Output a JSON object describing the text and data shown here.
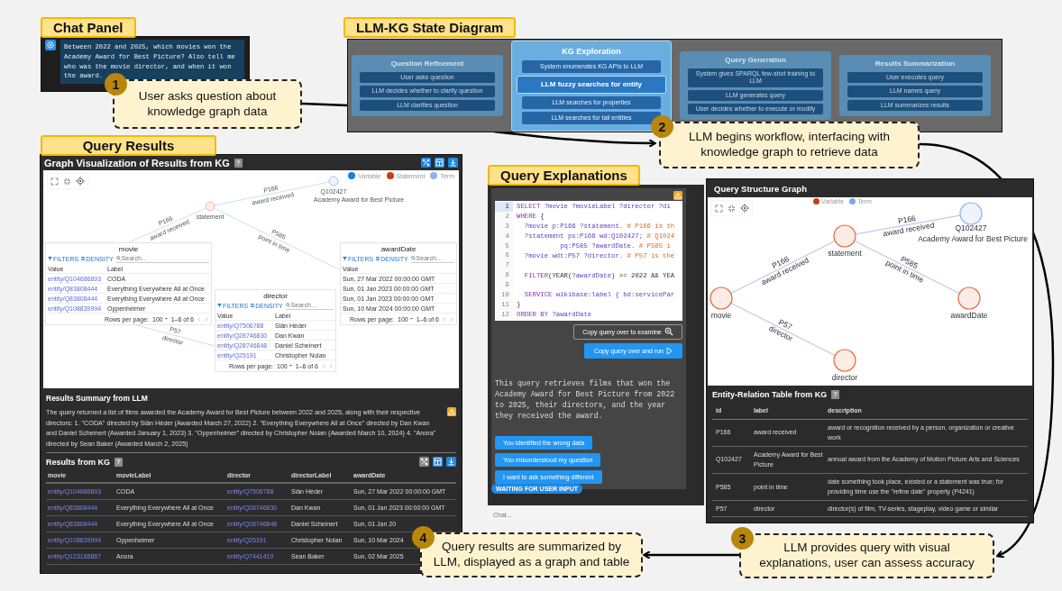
{
  "chat_panel": {
    "label": "Chat Panel",
    "message": "Between 2022 and 2025, which movies won the Academy Award for Best Picture? Also tell me who was the movie director, and when it won the award."
  },
  "state_diagram": {
    "label": "LLM-KG State Diagram",
    "stages": [
      {
        "title": "Question Refinement",
        "active": false,
        "steps": [
          {
            "text": "User asks question",
            "active": false
          },
          {
            "text": "LLM decides whether to clarify question",
            "active": false
          },
          {
            "text": "LLM clarifies question",
            "active": false
          }
        ]
      },
      {
        "title": "KG Exploration",
        "active": true,
        "steps": [
          {
            "text": "System enumerates KG APIs to LLM",
            "active": false
          },
          {
            "text": "LLM fuzzy searches for entity",
            "active": true
          },
          {
            "text": "LLM searches for properties",
            "active": false
          },
          {
            "text": "LLM searches for tail entities",
            "active": false
          }
        ]
      },
      {
        "title": "Query Generation",
        "active": false,
        "steps": [
          {
            "text": "System gives SPARQL few-shot training to LLM",
            "active": false
          },
          {
            "text": "LLM generates query",
            "active": false
          },
          {
            "text": "User decides whether to execute or modify",
            "active": false
          }
        ]
      },
      {
        "title": "Results Summarization",
        "active": false,
        "steps": [
          {
            "text": "User executes query",
            "active": false
          },
          {
            "text": "LLM names query",
            "active": false
          },
          {
            "text": "LLM summarizes results",
            "active": false
          }
        ]
      }
    ]
  },
  "query_results": {
    "label": "Query Results",
    "graph_panel": {
      "title": "Graph Visualization of Results from KG",
      "help": "?",
      "legend": [
        {
          "name": "Variable",
          "color": "#1a7cf5"
        },
        {
          "name": "Statement",
          "color": "#c2410c"
        },
        {
          "name": "Term",
          "color": "#8fb0f2"
        }
      ],
      "nodes": [
        {
          "label": "statement",
          "kind": "statement"
        },
        {
          "label": "Q102427",
          "sublabel": "Academy Award for Best Picture",
          "kind": "term"
        }
      ],
      "edges": [
        {
          "id": "P166",
          "label": "award received"
        },
        {
          "id": "P166",
          "label": "award received"
        },
        {
          "id": "P585",
          "label": "point in time"
        },
        {
          "id": "P57",
          "label": "director"
        }
      ],
      "tables": [
        {
          "title": "movie",
          "filters": "FILTERS",
          "density": "DENSITY",
          "search_placeholder": "Search…",
          "columns": [
            {
              "name": "Value",
              "kind": "link"
            },
            {
              "name": "Label",
              "kind": "text"
            }
          ],
          "rows": [
            [
              "entity/Q104686893",
              "CODA"
            ],
            [
              "entity/Q83808444",
              "Everything Everywhere All at Once"
            ],
            [
              "entity/Q83808444",
              "Everything Everywhere All at Once"
            ],
            [
              "entity/Q108839994",
              "Oppenheimer"
            ]
          ],
          "rows_per_page": "Rows per page:",
          "page_size": "100",
          "range": "1–6 of 6"
        },
        {
          "title": "director",
          "filters": "FILTERS",
          "density": "DENSITY",
          "search_placeholder": "Search…",
          "columns": [
            {
              "name": "Value",
              "kind": "link"
            },
            {
              "name": "Label",
              "kind": "text"
            }
          ],
          "rows": [
            [
              "entity/Q7506788",
              "Siân Héder"
            ],
            [
              "entity/Q28746830",
              "Dan Kwan"
            ],
            [
              "entity/Q28746848",
              "Daniel Scheinert"
            ],
            [
              "entity/Q25191",
              "Christopher Nolan"
            ]
          ],
          "rows_per_page": "Rows per page:",
          "page_size": "100",
          "range": "1–6 of 6"
        },
        {
          "title": "awardDate",
          "filters": "FILTERS",
          "density": "DENSITY",
          "search_placeholder": "Search…",
          "columns": [
            {
              "name": "Value",
              "kind": "text"
            }
          ],
          "rows": [
            [
              "Sun, 27 Mar 2022 00:00:00 GMT"
            ],
            [
              "Sun, 01 Jan 2023 00:00:00 GMT"
            ],
            [
              "Sun, 01 Jan 2023 00:00:00 GMT"
            ],
            [
              "Sun, 10 Mar 2024 00:00:00 GMT"
            ]
          ],
          "rows_per_page": "Rows per page:",
          "page_size": "100",
          "range": "1–6 of 6"
        }
      ]
    },
    "summary": {
      "title": "Results Summary from LLM",
      "text": "The query returned a list of films awarded the Academy Award for Best Picture between 2022 and 2025, along with their respective directors: 1. \"CODA\" directed by Siân Héder (Awarded March 27, 2022) 2. \"Everything Everywhere All at Once\" directed by Dan Kwan and Daniel Scheinert (Awarded January 1, 2023) 3. \"Oppenheimer\" directed by Christopher Nolan (Awarded March 10, 2024) 4. \"Anora\" directed by Sean Baker (Awarded March 2, 2025)"
    },
    "results_table": {
      "title": "Results from KG",
      "help": "?",
      "columns": [
        {
          "name": "movie",
          "kind": "link"
        },
        {
          "name": "movieLabel",
          "kind": "text"
        },
        {
          "name": "director",
          "kind": "link"
        },
        {
          "name": "directorLabel",
          "kind": "text"
        },
        {
          "name": "awardDate",
          "kind": "text"
        }
      ],
      "rows": [
        [
          "entity/Q104686893",
          "CODA",
          "entity/Q7506788",
          "Siân Héder",
          "Sun, 27 Mar 2022 00:00:00 GMT"
        ],
        [
          "entity/Q83808444",
          "Everything Everywhere All at Once",
          "entity/Q28746830",
          "Dan Kwan",
          "Sun, 01 Jan 2023 00:00:00 GMT"
        ],
        [
          "entity/Q83808444",
          "Everything Everywhere All at Once",
          "entity/Q28746848",
          "Daniel Scheinert",
          "Sun, 01 Jan 20"
        ],
        [
          "entity/Q108839994",
          "Oppenheimer",
          "entity/Q25191",
          "Christopher Nolan",
          "Sun, 10 Mar 2024"
        ],
        [
          "entity/Q123185887",
          "Anora",
          "entity/Q7441419",
          "Sean Baker",
          "Sun, 02 Mar 2025"
        ]
      ]
    }
  },
  "query_explanations": {
    "label": "Query Explanations",
    "code_lines": [
      {
        "number": "1",
        "active": true,
        "segments": [
          {
            "text": "SELECT",
            "kind": "keyword"
          },
          {
            "text": " ?movie ?movieLabel ?director ?di",
            "kind": "code"
          }
        ]
      },
      {
        "number": "2",
        "active": false,
        "segments": [
          {
            "text": "WHERE",
            "kind": "keyword"
          },
          {
            "text": " {",
            "kind": "plain"
          }
        ]
      },
      {
        "number": "3",
        "active": false,
        "segments": [
          {
            "text": "  ?movie p:P166 ?statement.",
            "kind": "code"
          },
          {
            "text": " # P166 is th",
            "kind": "comment"
          }
        ]
      },
      {
        "number": "4",
        "active": false,
        "segments": [
          {
            "text": "  ?statement ps:P166 wd:Q102427;",
            "kind": "code"
          },
          {
            "text": " # Q1024",
            "kind": "comment"
          }
        ]
      },
      {
        "number": "5",
        "active": false,
        "segments": [
          {
            "text": "           pq:P585 ?awardDate.",
            "kind": "code"
          },
          {
            "text": " # P585 i",
            "kind": "comment"
          }
        ]
      },
      {
        "number": "6",
        "active": false,
        "segments": [
          {
            "text": "  ?movie wdt:P57 ?director.",
            "kind": "code"
          },
          {
            "text": " # P57 is the",
            "kind": "comment"
          }
        ]
      },
      {
        "number": "7",
        "active": false
      },
      {
        "number": "8",
        "active": false,
        "segments": [
          {
            "text": "  FILTER",
            "kind": "keyword"
          },
          {
            "text": "(YEAR(",
            "kind": "plain"
          },
          {
            "text": "?awardDate",
            "kind": "code"
          },
          {
            "text": ") >= 2022 && YEA",
            "kind": "plain"
          }
        ]
      },
      {
        "number": "9",
        "active": false
      },
      {
        "number": "10",
        "active": false,
        "segments": [
          {
            "text": "  SERVICE",
            "kind": "keyword"
          },
          {
            "text": " wikibase:label { bd:servicePar",
            "kind": "code"
          }
        ]
      },
      {
        "number": "11",
        "active": false,
        "segments": [
          {
            "text": "}",
            "kind": "plain"
          }
        ]
      },
      {
        "number": "12",
        "active": false,
        "segments": [
          {
            "text": "ORDER BY",
            "kind": "keyword"
          },
          {
            "text": " ?awardDate",
            "kind": "code"
          }
        ]
      }
    ],
    "copy_buttons": [
      {
        "text": "Copy query over to examine",
        "kind": "outline"
      },
      {
        "text": "Copy query over and run",
        "kind": "primary"
      }
    ],
    "explanation": "This query retrieves films that won the Academy Award for Best Picture from 2022 to 2025, their directors, and the year they received the award.",
    "feedback_buttons": [
      "You identified the wrong data",
      "You misunderstood my question",
      "I want to ask something different"
    ],
    "status": "WAITING FOR USER INPUT",
    "chat_placeholder": "Chat..."
  },
  "query_structure": {
    "title": "Query Structure Graph",
    "legend": [
      {
        "name": "Variable",
        "color": "#c2410c"
      },
      {
        "name": "Term",
        "color": "#7fa7f0"
      }
    ],
    "nodes": [
      {
        "label": "statement",
        "kind": "variable"
      },
      {
        "label": "Q102427",
        "sublabel": "Academy Award for Best Picture",
        "kind": "term"
      },
      {
        "label": "movie",
        "kind": "variable"
      },
      {
        "label": "awardDate",
        "kind": "variable"
      },
      {
        "label": "director",
        "kind": "variable"
      }
    ],
    "edges": [
      {
        "id": "P166",
        "label": "award received"
      },
      {
        "id": "P166",
        "label": "award received"
      },
      {
        "id": "P585",
        "label": "point in time"
      },
      {
        "id": "P57",
        "label": "director"
      }
    ],
    "er_table": {
      "title": "Entity-Relation Table from KG",
      "help": "?",
      "columns": [
        "id",
        "label",
        "description"
      ],
      "rows": [
        [
          "P166",
          "award received",
          "award or recognition received by a person, organization or creative work"
        ],
        [
          "Q102427",
          "Academy Award for Best Picture",
          "annual award from the Academy of Motion Picture Arts and Sciences"
        ],
        [
          "P585",
          "point in time",
          "date something took place, existed or a statement was true; for providing time use the \"refine date\" property (P4241)"
        ],
        [
          "P57",
          "director",
          "director(s) of film, TV-series, stageplay, video game or similar"
        ]
      ]
    }
  },
  "callouts": [
    {
      "number": "1",
      "text": "User asks question about knowledge graph data"
    },
    {
      "number": "2",
      "text": "LLM begins workflow, interfacing with knowledge graph to retrieve data"
    },
    {
      "number": "4",
      "text": "Query results are summarized by LLM, displayed as a graph and table"
    },
    {
      "number": "3",
      "text": "LLM provides query with visual explanations, user can assess accuracy"
    }
  ]
}
